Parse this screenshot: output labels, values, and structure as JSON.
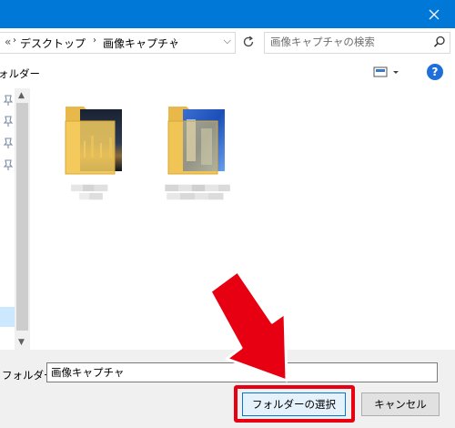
{
  "address_bar": {
    "overflow": "«",
    "breadcrumbs": [
      "デスクトップ",
      "画像キャプチャ"
    ]
  },
  "search": {
    "placeholder": "画像キャプチャの検索"
  },
  "toolbar": {
    "new_folder": "ォルダー",
    "help": "?"
  },
  "content": {
    "folders": [
      {
        "icon": "folder-with-city-night-photo-icon",
        "label_blurred": true
      },
      {
        "icon": "folder-with-blue-photo-icon",
        "label_blurred": true
      }
    ]
  },
  "footer": {
    "folder_label": "フォルダー:",
    "folder_value": "画像キャプチャ",
    "select_button": "フォルダーの選択",
    "cancel_button": "キャンセル"
  },
  "colors": {
    "titlebar": "#0078d7",
    "highlight": "#e60012",
    "primary_button_border": "#0078d7",
    "help_icon": "#1e6fd9"
  }
}
